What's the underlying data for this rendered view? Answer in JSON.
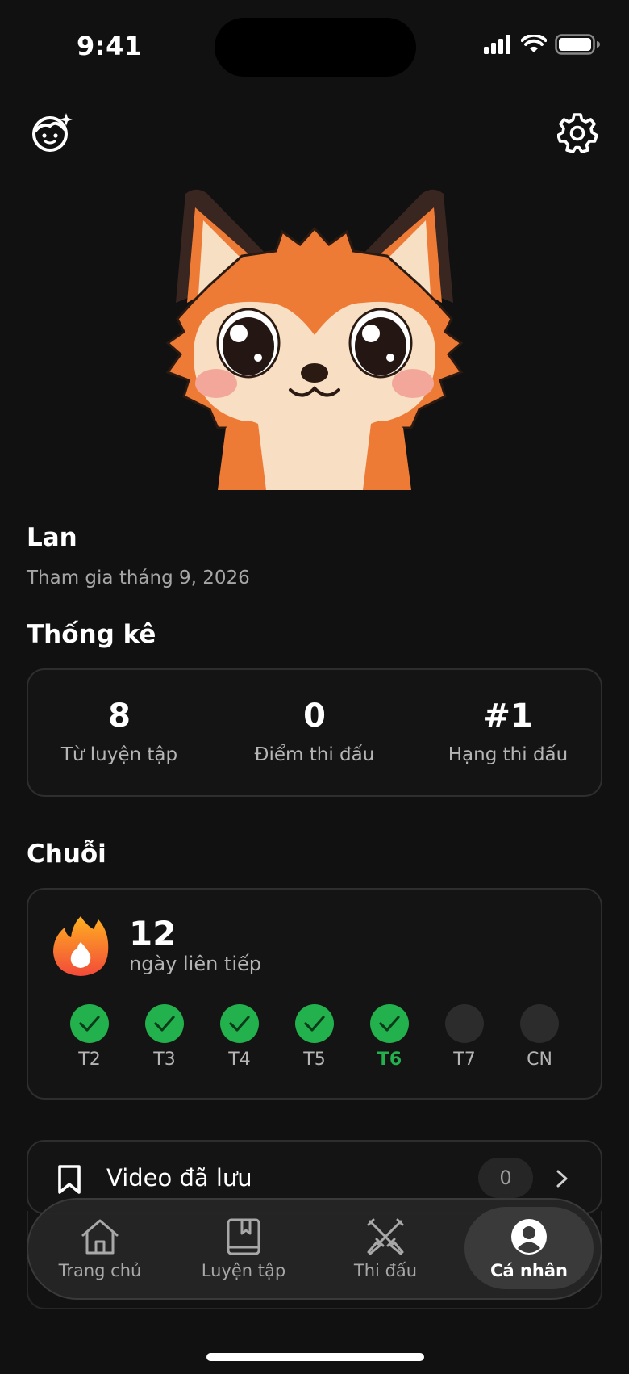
{
  "status_bar": {
    "time": "9:41"
  },
  "header": {
    "left_icon": "kid-avatar-sparkle-icon",
    "right_icon": "gear-icon"
  },
  "profile": {
    "name": "Lan",
    "joined": "Tham gia tháng 9, 2026"
  },
  "stats": {
    "title": "Thống kê",
    "items": [
      {
        "value": "8",
        "label": "Từ luyện tập"
      },
      {
        "value": "0",
        "label": "Điểm thi đấu"
      },
      {
        "value": "#1",
        "label": "Hạng thi đấu"
      }
    ]
  },
  "streak": {
    "title": "Chuỗi",
    "count": "12",
    "subtitle": "ngày liên tiếp",
    "days": [
      {
        "label": "T2",
        "done": true
      },
      {
        "label": "T3",
        "done": true
      },
      {
        "label": "T4",
        "done": true
      },
      {
        "label": "T5",
        "done": true
      },
      {
        "label": "T6",
        "done": true,
        "today": true
      },
      {
        "label": "T7",
        "done": false
      },
      {
        "label": "CN",
        "done": false
      }
    ]
  },
  "saved": {
    "label": "Video đã lưu",
    "count": "0"
  },
  "tabbar": {
    "tabs": [
      {
        "label": "Trang chủ",
        "icon": "home-icon"
      },
      {
        "label": "Luyện tập",
        "icon": "book-icon"
      },
      {
        "label": "Thi đấu",
        "icon": "crossed-swords-icon"
      },
      {
        "label": "Cá nhân",
        "icon": "person-icon",
        "active": true
      }
    ]
  },
  "colors": {
    "background": "#111111",
    "accent_green": "#22b14c",
    "fox_orange": "#ee7b35"
  }
}
